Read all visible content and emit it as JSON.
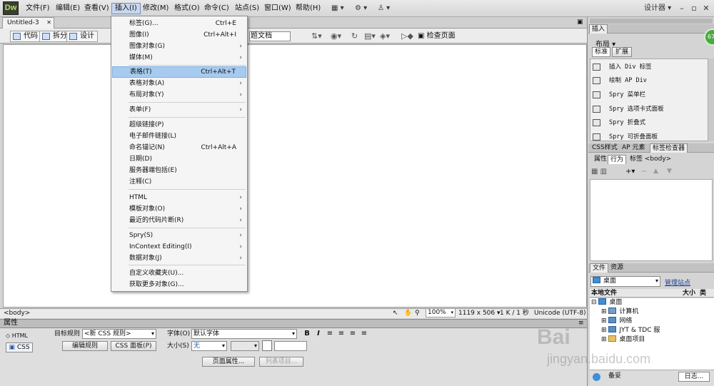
{
  "app": {
    "logo": "Dw"
  },
  "menubar": {
    "items": [
      "文件(F)",
      "编辑(E)",
      "查看(V)",
      "插入(I)",
      "修改(M)",
      "格式(O)",
      "命令(C)",
      "站点(S)",
      "窗口(W)",
      "帮助(H)"
    ],
    "active": "插入(I)",
    "workspace": "设计器"
  },
  "document": {
    "tab": "Untitled-3",
    "views": [
      "代码",
      "拆分",
      "设计"
    ],
    "title_value": "无标题文档",
    "title_visible": "题文档",
    "check_page": "检查页面",
    "tag_selector": "<body>",
    "zoom": "100%",
    "size_info": "1119 x 506",
    "file_info": "1 K / 1 秒",
    "encoding": "Unicode (UTF-8)"
  },
  "insert_menu": [
    {
      "label": "标签(G)...",
      "shortcut": "Ctrl+E"
    },
    {
      "label": "图像(I)",
      "shortcut": "Ctrl+Alt+I"
    },
    {
      "label": "图像对象(G)",
      "submenu": true
    },
    {
      "label": "媒体(M)",
      "submenu": true
    },
    {
      "label": "表格(T)",
      "shortcut": "Ctrl+Alt+T",
      "highlighted": true
    },
    {
      "label": "表格对象(A)",
      "submenu": true
    },
    {
      "label": "布局对象(Y)",
      "submenu": true
    },
    {
      "label": "表单(F)",
      "submenu": true
    },
    {
      "label": "超级链接(P)"
    },
    {
      "label": "电子邮件链接(L)"
    },
    {
      "label": "命名锚记(N)",
      "shortcut": "Ctrl+Alt+A"
    },
    {
      "label": "日期(D)"
    },
    {
      "label": "服务器端包括(E)"
    },
    {
      "label": "注释(C)"
    },
    {
      "label": "HTML",
      "submenu": true
    },
    {
      "label": "模板对象(O)",
      "submenu": true
    },
    {
      "label": "最近的代码片断(R)",
      "submenu": true
    },
    {
      "label": "Spry(S)",
      "submenu": true
    },
    {
      "label": "InContext Editing(I)",
      "submenu": true
    },
    {
      "label": "数据对象(J)",
      "submenu": true
    },
    {
      "label": "自定义收藏夹(U)..."
    },
    {
      "label": "获取更多对象(G)..."
    }
  ],
  "properties": {
    "title": "属性",
    "html_btn": "HTML",
    "css_btn": "CSS",
    "target_rule_label": "目标规则",
    "target_rule_value": "<新 CSS 规则>",
    "edit_rule": "编辑规则",
    "css_panel": "CSS 面板(P)",
    "font_label": "字体(O)",
    "font_value": "默认字体",
    "size_label": "大小(S)",
    "size_value": "无",
    "page_props": "页面属性...",
    "list_item": "列表项目..."
  },
  "insert_panel": {
    "title": "插入",
    "category": "布局",
    "tabs": [
      "标准",
      "扩展"
    ],
    "items": [
      "插入 Div 标签",
      "绘制 AP Div",
      "Spry 菜单栏",
      "Spry 选项卡式面板",
      "Spry 折叠式",
      "Spry 可折叠面板"
    ],
    "badge": "67"
  },
  "tag_panel": {
    "tabs": [
      "CSS样式",
      "AP 元素",
      "标签检查器"
    ],
    "subtabs": [
      "属性",
      "行为"
    ],
    "tag_label": "标签 <body>"
  },
  "files_panel": {
    "tabs": [
      "文件",
      "资源"
    ],
    "location": "桌面",
    "manage_site": "管理站点",
    "col_local": "本地文件",
    "col_size": "大小",
    "col_type": "类",
    "tree": [
      "桌面",
      "计算机",
      "网络",
      "JYT & TDC 服",
      "桌面项目"
    ],
    "ready": "备妥",
    "log": "日志..."
  },
  "watermark": {
    "line1": "Bai",
    "line2": "jingyan.baidu.com"
  },
  "colors": {
    "menu_highlight": "#a7cbf0",
    "logo_bg": "#3a3f32",
    "logo_fg": "#b8e05d"
  }
}
